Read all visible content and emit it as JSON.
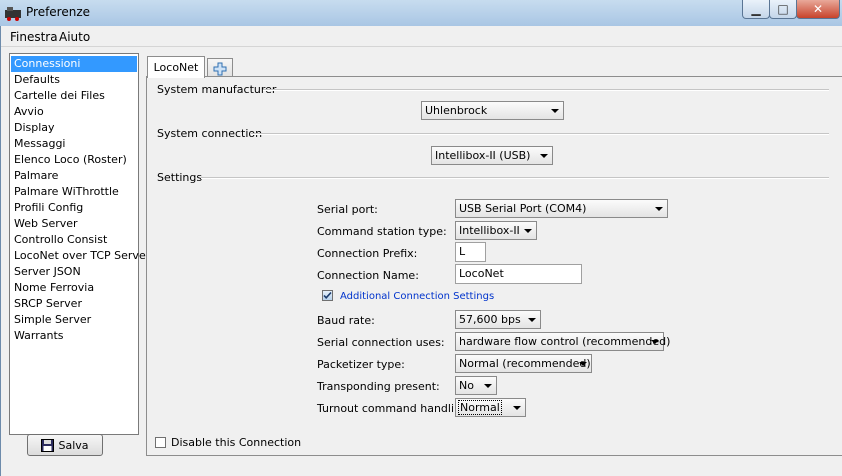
{
  "window": {
    "title": "Preferenze"
  },
  "menu": [
    "Finestra",
    "Aiuto"
  ],
  "sidebar": {
    "items": [
      "Connessioni",
      "Defaults",
      "Cartelle dei Files",
      "Avvio",
      "Display",
      "Messaggi",
      "Elenco Loco (Roster)",
      "Palmare",
      "Palmare WiThrottle",
      "Profili Config",
      "Web Server",
      "Controllo Consist",
      "LocoNet over TCP Server",
      "Server JSON",
      "Nome Ferrovia",
      "SRCP Server",
      "Simple Server",
      "Warrants"
    ],
    "selected_index": 0
  },
  "save_label": "Salva",
  "tabs": {
    "active": "LocoNet",
    "add_symbol": "+"
  },
  "sections": {
    "manufacturer": "System manufacturer",
    "connection": "System connection",
    "settings": "Settings"
  },
  "manufacturer_value": "Uhlenbrock",
  "connection_value": "Intellibox-II (USB)",
  "settings": {
    "serial_port_label": "Serial port:",
    "serial_port_value": "USB Serial Port (COM4)",
    "cmd_station_label": "Command station type:",
    "cmd_station_value": "Intellibox-II",
    "prefix_label": "Connection Prefix:",
    "prefix_value": "L",
    "name_label": "Connection Name:",
    "name_value": "LocoNet",
    "additional_label": "Additional Connection Settings",
    "additional_checked": true,
    "baud_label": "Baud rate:",
    "baud_value": "57,600 bps",
    "flow_label": "Serial connection uses:",
    "flow_value": "hardware flow control (recommended)",
    "packetizer_label": "Packetizer type:",
    "packetizer_value": "Normal (recommended)",
    "transponding_label": "Transponding present:",
    "transponding_value": "No",
    "turnout_label": "Turnout command handling:",
    "turnout_value": "Normal"
  },
  "disable_label": "Disable this Connection",
  "disable_checked": false,
  "colors": {
    "selection": "#3399ff",
    "link_text": "#0033cc",
    "titlebar": "#b9d1ea"
  }
}
